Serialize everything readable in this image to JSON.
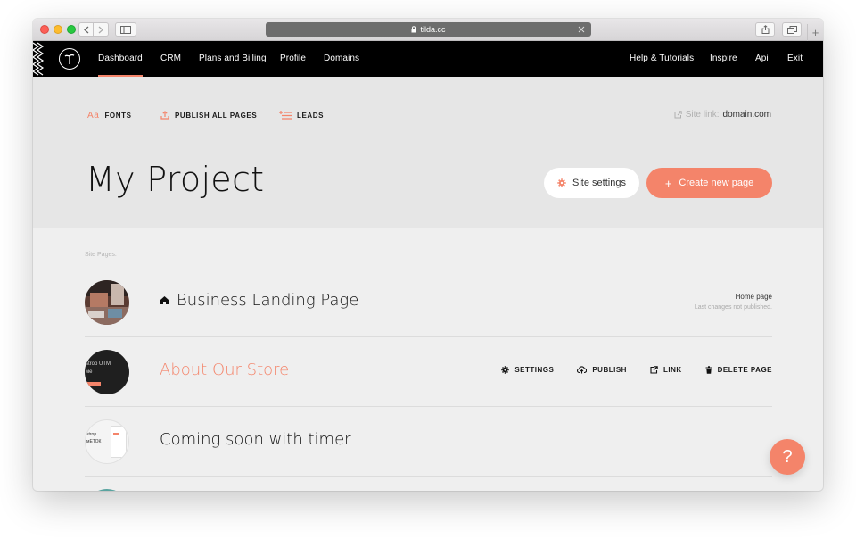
{
  "browser": {
    "url": "tilda.cc"
  },
  "nav": {
    "left": [
      {
        "label": "Dashboard",
        "active": true
      },
      {
        "label": "CRM"
      },
      {
        "label": "Plans and Billing"
      },
      {
        "label": "Profile"
      },
      {
        "label": "Domains"
      }
    ],
    "right": [
      {
        "label": "Help & Tutorials"
      },
      {
        "label": "Inspire"
      },
      {
        "label": "Api"
      },
      {
        "label": "Exit"
      }
    ]
  },
  "toolbar": {
    "fonts_icon": "Aa",
    "fonts_label": "FONTS",
    "publish_label": "PUBLISH ALL PAGES",
    "leads_label": "LEADS",
    "site_link_label": "Site link:",
    "site_link_value": "domain.com"
  },
  "project": {
    "title": "My Project",
    "settings_label": "Site settings",
    "create_label": "Create new page"
  },
  "pages": {
    "section_label": "Site Pages:",
    "items": [
      {
        "title": "Business Landing Page",
        "home_label": "Home page",
        "home_sub": "Last changes not published."
      },
      {
        "title": "About Our Store",
        "thumb_text": "strop UTM ме Publishing"
      },
      {
        "title": "Coming soon with timer",
        "thumb_text": "strop мЕТОК"
      }
    ],
    "actions": {
      "settings": "SETTINGS",
      "publish": "PUBLISH",
      "link": "LINK",
      "delete": "DELETE PAGE"
    }
  },
  "help": {
    "label": "?"
  },
  "colors": {
    "accent": "#f4846a",
    "navbar": "#000000",
    "header_bg": "#e6e6e6",
    "body_bg": "#efefef"
  }
}
